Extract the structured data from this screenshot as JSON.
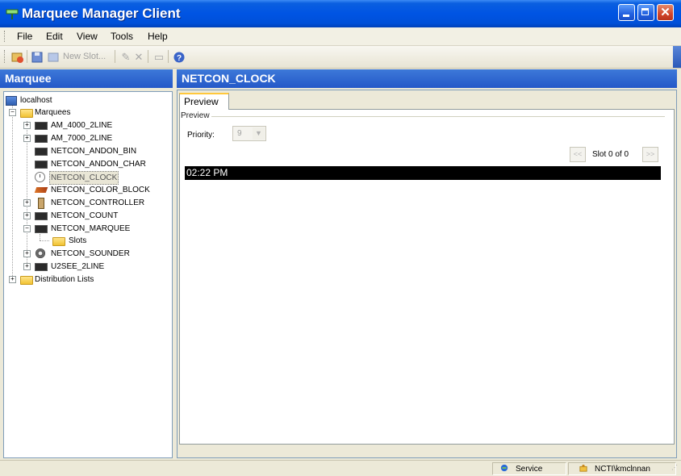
{
  "window": {
    "title": "Marquee Manager Client",
    "controls": [
      "minimize",
      "maximize",
      "close"
    ]
  },
  "menu": [
    {
      "label": "File"
    },
    {
      "label": "Edit"
    },
    {
      "label": "View"
    },
    {
      "label": "Tools"
    },
    {
      "label": "Help"
    }
  ],
  "toolbar": {
    "new_slot_label": "New Slot...",
    "icons": [
      "refresh-icon",
      "save-icon",
      "new-slot-icon",
      "edit-icon",
      "delete-icon",
      "copy-icon",
      "help-icon"
    ]
  },
  "left_pane": {
    "header": "Marquee",
    "tree": {
      "root": "localhost",
      "marquees_label": "Marquees",
      "items": [
        {
          "label": "AM_4000_2LINE",
          "icon": "sign-icon",
          "expandable": true
        },
        {
          "label": "AM_7000_2LINE",
          "icon": "sign-icon",
          "expandable": true
        },
        {
          "label": "NETCON_ANDON_BIN",
          "icon": "sign-icon",
          "expandable": false
        },
        {
          "label": "NETCON_ANDON_CHAR",
          "icon": "sign-icon",
          "expandable": false
        },
        {
          "label": "NETCON_CLOCK",
          "icon": "clock-icon",
          "expandable": false,
          "selected": true
        },
        {
          "label": "NETCON_COLOR_BLOCK",
          "icon": "color-block-icon",
          "expandable": false
        },
        {
          "label": "NETCON_CONTROLLER",
          "icon": "controller-icon",
          "expandable": true
        },
        {
          "label": "NETCON_COUNT",
          "icon": "sign-icon",
          "expandable": true
        },
        {
          "label": "NETCON_MARQUEE",
          "icon": "sign-icon",
          "expandable": true,
          "expanded": true
        },
        {
          "label": "Slots",
          "icon": "folder-icon",
          "child": true
        },
        {
          "label": "NETCON_SOUNDER",
          "icon": "sounder-icon",
          "expandable": true
        },
        {
          "label": "U2SEE_2LINE",
          "icon": "sign-icon",
          "expandable": true
        }
      ],
      "distribution_label": "Distribution Lists"
    }
  },
  "right_pane": {
    "header": "NETCON_CLOCK",
    "tab": "Preview",
    "group_title": "Preview",
    "priority_label": "Priority:",
    "priority_value": "9",
    "prev_label": "<<",
    "next_label": ">>",
    "slot_counter": "Slot 0 of 0",
    "display_text": "02:22 PM"
  },
  "status": {
    "service_label": "Service",
    "user_label": "NCTI\\kmclnnan"
  },
  "colors": {
    "title_bar": "#0054e3",
    "pane_header": "#2f66d0",
    "display_bg": "#000000",
    "display_fg": "#ffffff"
  }
}
